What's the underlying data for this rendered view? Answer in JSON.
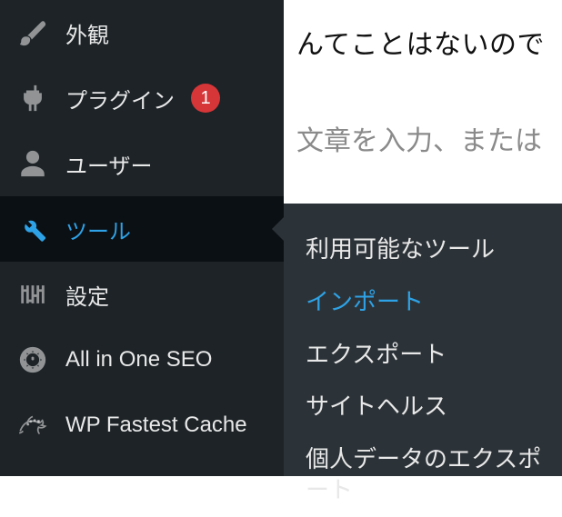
{
  "sidebar": {
    "items": [
      {
        "id": "appearance",
        "label": "外観",
        "icon": "brush-icon"
      },
      {
        "id": "plugins",
        "label": "プラグイン",
        "icon": "plug-icon",
        "badge": "1"
      },
      {
        "id": "users",
        "label": "ユーザー",
        "icon": "user-icon"
      },
      {
        "id": "tools",
        "label": "ツール",
        "icon": "wrench-icon",
        "active": true
      },
      {
        "id": "settings",
        "label": "設定",
        "icon": "sliders-icon"
      },
      {
        "id": "aioseo",
        "label": "All in One SEO",
        "icon": "gear-badge-icon"
      },
      {
        "id": "wpfc",
        "label": "WP Fastest Cache",
        "icon": "cheetah-icon"
      }
    ]
  },
  "flyout": {
    "items": [
      {
        "id": "available",
        "label": "利用可能なツール"
      },
      {
        "id": "import",
        "label": "インポート",
        "active": true
      },
      {
        "id": "export",
        "label": "エクスポート"
      },
      {
        "id": "sitehealth",
        "label": "サイトヘルス"
      },
      {
        "id": "export-personal",
        "label": "個人データのエクスポート"
      }
    ]
  },
  "content": {
    "title_fragment": "んてことはないので",
    "placeholder_fragment": "文章を入力、または"
  },
  "colors": {
    "sidebar_bg": "#1d2327",
    "flyout_bg": "#2c3338",
    "accent": "#2ea2e6",
    "badge": "#d63638"
  }
}
